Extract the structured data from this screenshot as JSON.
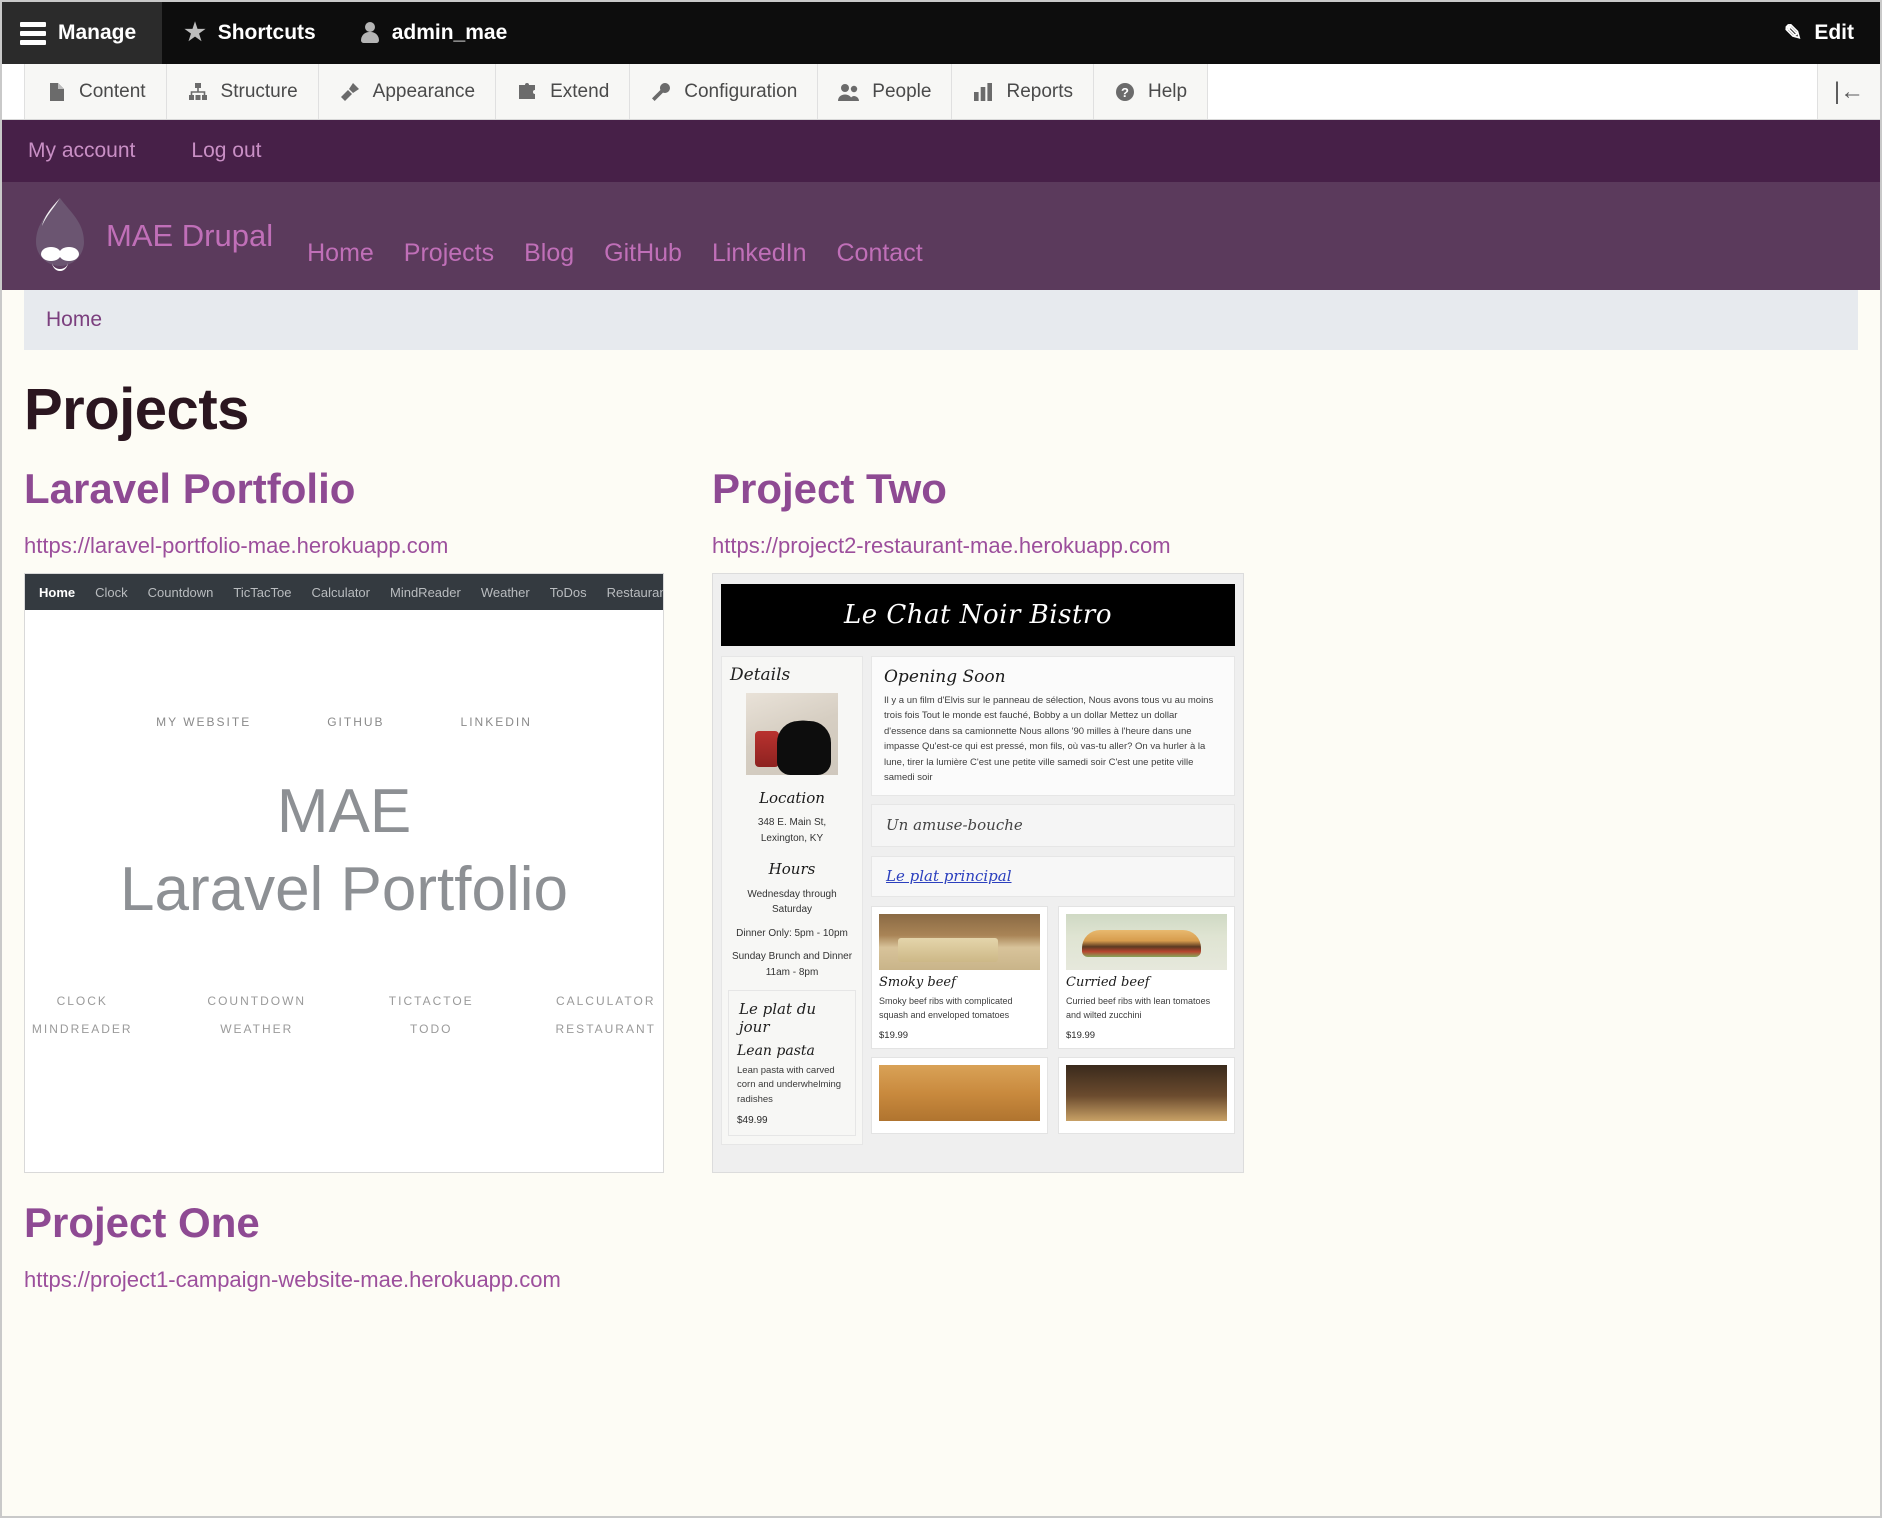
{
  "admin_toolbar": {
    "manage_label": "Manage",
    "shortcuts_label": "Shortcuts",
    "user_label": "admin_mae",
    "edit_label": "Edit",
    "menu": [
      {
        "label": "Content",
        "icon": "document-icon"
      },
      {
        "label": "Structure",
        "icon": "sitemap-icon"
      },
      {
        "label": "Appearance",
        "icon": "paintbrush-icon"
      },
      {
        "label": "Extend",
        "icon": "puzzle-icon"
      },
      {
        "label": "Configuration",
        "icon": "wrench-icon"
      },
      {
        "label": "People",
        "icon": "people-icon"
      },
      {
        "label": "Reports",
        "icon": "bar-chart-icon"
      },
      {
        "label": "Help",
        "icon": "question-mark-icon"
      }
    ],
    "collapse_glyph": "|←"
  },
  "user_bar": {
    "my_account": "My account",
    "log_out": "Log out"
  },
  "site_header": {
    "site_name": "MAE Drupal",
    "nav": [
      {
        "label": "Home"
      },
      {
        "label": "Projects"
      },
      {
        "label": "Blog"
      },
      {
        "label": "GitHub"
      },
      {
        "label": "LinkedIn"
      },
      {
        "label": "Contact"
      }
    ]
  },
  "breadcrumb": {
    "items": [
      {
        "label": "Home"
      }
    ]
  },
  "page": {
    "title": "Projects"
  },
  "projects": {
    "laravel": {
      "title": "Laravel Portfolio",
      "url": "https://laravel-portfolio-mae.herokuapp.com",
      "screenshot": {
        "nav": [
          "Home",
          "Clock",
          "Countdown",
          "TicTacToe",
          "Calculator",
          "MindReader",
          "Weather",
          "ToDos",
          "Restaurant"
        ],
        "top_links": [
          "MY WEBSITE",
          "GITHUB",
          "LINKEDIN"
        ],
        "hero_line1": "MAE",
        "hero_line2": "Laravel Portfolio",
        "grid_row1": [
          "CLOCK",
          "COUNTDOWN",
          "TICTACTOE",
          "CALCULATOR"
        ],
        "grid_row2": [
          "MINDREADER",
          "WEATHER",
          "TODO",
          "RESTAURANT"
        ]
      }
    },
    "two": {
      "title": "Project Two",
      "url": "https://project2-restaurant-mae.herokuapp.com",
      "screenshot": {
        "brand": "Le Chat Noir Bistro",
        "details_heading": "Details",
        "location_label": "Location",
        "location_line1": "348 E. Main St,",
        "location_line2": "Lexington, KY",
        "hours_label": "Hours",
        "hours_line1": "Wednesday through",
        "hours_line2": "Saturday",
        "hours_line3": "Dinner Only: 5pm - 10pm",
        "hours_line4": "Sunday Brunch and Dinner",
        "hours_line5": "11am - 8pm",
        "plat_du_jour_label": "Le plat du jour",
        "plat_du_jour_name": "Lean pasta",
        "plat_du_jour_desc": "Lean pasta with carved corn and underwhelming radishes",
        "plat_du_jour_price": "$49.99",
        "opening_title": "Opening Soon",
        "opening_body": "Il y a un film d'Elvis sur le panneau de sélection, Nous avons tous vu au moins trois fois Tout le monde est fauché, Bobby a un dollar Mettez un dollar d'essence dans sa camionnette Nous allons '90 milles à l'heure dans une impasse Qu'est-ce qui est pressé, mon fils, où vas-tu aller? On va hurler à la lune, tirer la lumière C'est une petite ville samedi soir C'est une petite ville samedi soir",
        "amuse_label": "Un amuse-bouche",
        "principal_label": "Le plat principal",
        "dishes": [
          {
            "name": "Smoky beef",
            "desc": "Smoky beef ribs with complicated squash and enveloped tomatoes",
            "price": "$19.99"
          },
          {
            "name": "Curried beef",
            "desc": "Curried beef ribs with lean tomatoes and wilted zucchini",
            "price": "$19.99"
          }
        ]
      }
    },
    "one": {
      "title": "Project One",
      "url": "https://project1-campaign-website-mae.herokuapp.com"
    }
  },
  "colors": {
    "admin_bar_bg": "#0d0d0d",
    "user_bar_bg": "#472048",
    "site_header_bg": "#5b3a5c",
    "brand_pink": "#c06fb8",
    "heading_purple": "#8e4a93",
    "page_bg": "#fdfcf5"
  }
}
